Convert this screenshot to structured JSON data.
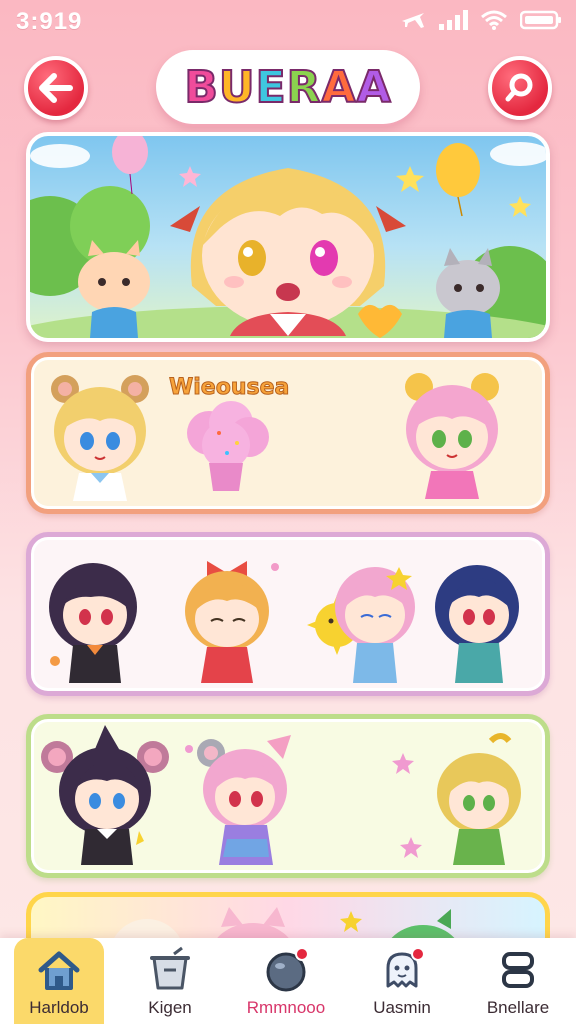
{
  "status_bar": {
    "time": "3:919"
  },
  "header": {
    "logo_text": "BUERAA",
    "logo_colors": [
      "#f04c9b",
      "#ffb627",
      "#3ec7e0",
      "#8bd24f",
      "#ff6b3d",
      "#b15ce6"
    ]
  },
  "cards": [
    {
      "id": "hero",
      "title": ""
    },
    {
      "id": "yellow",
      "title": "Wieousea"
    },
    {
      "id": "purple",
      "title": ""
    },
    {
      "id": "green",
      "title": ""
    },
    {
      "id": "rainbow",
      "title": ""
    }
  ],
  "bottom_nav": {
    "items": [
      {
        "label": "Harldob",
        "icon": "home-icon",
        "active": true
      },
      {
        "label": "Kigen",
        "icon": "bucket-icon",
        "active": false
      },
      {
        "label": "Rmmnooo",
        "icon": "ball-icon",
        "active": false,
        "badge": true
      },
      {
        "label": "Uasmin",
        "icon": "ghost-icon",
        "active": false,
        "badge": true
      },
      {
        "label": "Bnellare",
        "icon": "stack-icon",
        "active": false
      }
    ]
  },
  "colors": {
    "accent": "#e4283f",
    "nav_active": "#fbd96a",
    "background": "#fcc6ce"
  }
}
